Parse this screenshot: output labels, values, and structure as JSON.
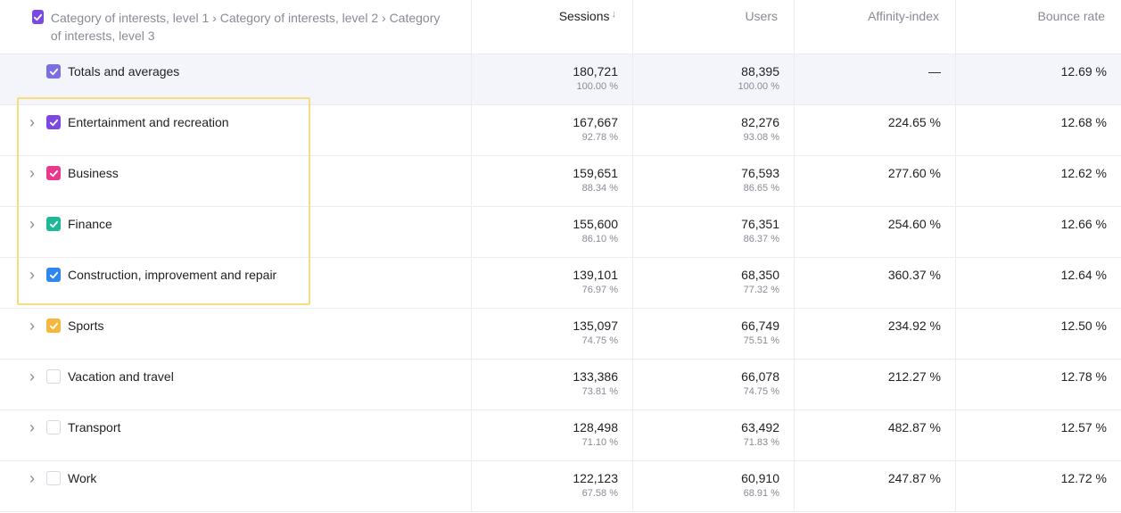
{
  "header": {
    "dimension_title": "Category of interests, level 1 › Category of interests, level 2 › Category of interests, level 3",
    "header_check_color": "#7b48e6",
    "columns": [
      "Sessions",
      "Users",
      "Affinity-index",
      "Bounce rate"
    ],
    "sort_indicator": "↓"
  },
  "totals": {
    "label": "Totals and averages",
    "check_color": "#7c6fe0",
    "sessions": "180,721",
    "sessions_pct": "100.00 %",
    "users": "88,395",
    "users_pct": "100.00 %",
    "affinity": "—",
    "bounce": "12.69 %"
  },
  "rows": [
    {
      "label": "Entertainment and recreation",
      "checked": true,
      "check_color": "#7b48e6",
      "sessions": "167,667",
      "sessions_pct": "92.78 %",
      "users": "82,276",
      "users_pct": "93.08 %",
      "affinity": "224.65 %",
      "bounce": "12.68 %"
    },
    {
      "label": "Business",
      "checked": true,
      "check_color": "#e8398c",
      "sessions": "159,651",
      "sessions_pct": "88.34 %",
      "users": "76,593",
      "users_pct": "86.65 %",
      "affinity": "277.60 %",
      "bounce": "12.62 %"
    },
    {
      "label": "Finance",
      "checked": true,
      "check_color": "#1fb99a",
      "sessions": "155,600",
      "sessions_pct": "86.10 %",
      "users": "76,351",
      "users_pct": "86.37 %",
      "affinity": "254.60 %",
      "bounce": "12.66 %"
    },
    {
      "label": "Construction, improvement and repair",
      "checked": true,
      "check_color": "#2f86f0",
      "sessions": "139,101",
      "sessions_pct": "76.97 %",
      "users": "68,350",
      "users_pct": "77.32 %",
      "affinity": "360.37 %",
      "bounce": "12.64 %"
    },
    {
      "label": "Sports",
      "checked": true,
      "check_color": "#f6b73c",
      "sessions": "135,097",
      "sessions_pct": "74.75 %",
      "users": "66,749",
      "users_pct": "75.51 %",
      "affinity": "234.92 %",
      "bounce": "12.50 %"
    },
    {
      "label": "Vacation and travel",
      "checked": false,
      "check_color": "",
      "sessions": "133,386",
      "sessions_pct": "73.81 %",
      "users": "66,078",
      "users_pct": "74.75 %",
      "affinity": "212.27 %",
      "bounce": "12.78 %"
    },
    {
      "label": "Transport",
      "checked": false,
      "check_color": "",
      "sessions": "128,498",
      "sessions_pct": "71.10 %",
      "users": "63,492",
      "users_pct": "71.83 %",
      "affinity": "482.87 %",
      "bounce": "12.57 %"
    },
    {
      "label": "Work",
      "checked": false,
      "check_color": "",
      "sessions": "122,123",
      "sessions_pct": "67.58 %",
      "users": "60,910",
      "users_pct": "68.91 %",
      "affinity": "247.87 %",
      "bounce": "12.72 %"
    }
  ],
  "highlight_color": "#f6dd7f"
}
